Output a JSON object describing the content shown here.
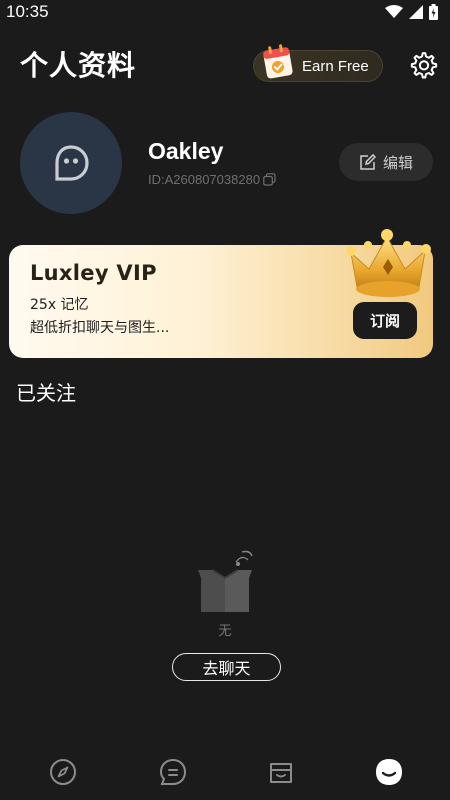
{
  "status_bar": {
    "time": "10:35",
    "icons": [
      "wifi-icon",
      "signal-icon",
      "battery-icon"
    ]
  },
  "header": {
    "title": "个人资料",
    "earn_label": "Earn Free",
    "earn_icon": "calendar-check-icon",
    "settings_icon": "gear-icon"
  },
  "profile": {
    "username": "Oakley",
    "user_id": "ID:A260807038280",
    "copy_icon": "copy-icon",
    "edit_label": "编辑",
    "edit_icon": "edit-icon",
    "avatar_icon": "chat-face-icon"
  },
  "vip": {
    "title": "Luxley VIP",
    "line1": "25x 记忆",
    "line2": "超低折扣聊天与图生...",
    "subscribe_label": "订阅",
    "crown_icon": "crown-icon"
  },
  "following": {
    "title": "已关注",
    "empty_label": "无",
    "chat_button_label": "去聊天"
  },
  "bottom_nav": {
    "items": [
      {
        "icon": "compass-icon",
        "active": false
      },
      {
        "icon": "message-icon",
        "active": false
      },
      {
        "icon": "box-icon",
        "active": false
      },
      {
        "icon": "profile-face-icon",
        "active": true
      }
    ]
  },
  "colors": {
    "background": "#1b1b1b",
    "vip_gold": "#f1c97e",
    "avatar_bg": "#2a3645"
  }
}
